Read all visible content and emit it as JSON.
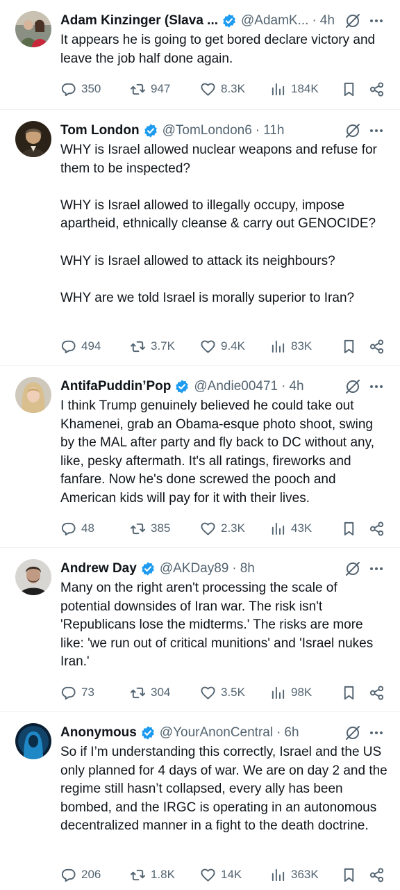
{
  "colors": {
    "verified": "#1d9bf0",
    "text": "#0f1419",
    "muted": "#536471",
    "divider": "#eff3f4"
  },
  "icons": {
    "verified": "verified-badge-icon",
    "grok": "grok-icon",
    "more": "more-icon",
    "reply": "reply-icon",
    "retweet": "retweet-icon",
    "like": "like-icon",
    "views": "views-icon",
    "bookmark": "bookmark-icon",
    "share": "share-icon"
  },
  "tweets": [
    {
      "name": "Adam Kinzinger (Slava ...",
      "handle": "@AdamK...",
      "sep": "·",
      "time": "4h",
      "text": "It appears he is going to get bored declare victory and leave the job half done again.",
      "replies": "350",
      "retweets": "947",
      "likes": "8.3K",
      "views": "184K"
    },
    {
      "name": "Tom London",
      "handle": "@TomLondon6",
      "sep": "·",
      "time": "11h",
      "text": "WHY is Israel allowed nuclear weapons and refuse for them to be inspected?\n\nWHY is Israel allowed to illegally occupy, impose apartheid, ethnically cleanse & carry out GENOCIDE?\n\nWHY is Israel allowed to attack its neighbours?\n\nWHY are we told Israel is morally superior to Iran?",
      "replies": "494",
      "retweets": "3.7K",
      "likes": "9.4K",
      "views": "83K"
    },
    {
      "name": "AntifaPuddin’Pop",
      "handle": "@Andie00471",
      "sep": "·",
      "time": "4h",
      "text": "I think Trump genuinely believed he could take out Khamenei, grab an Obama-esque photo shoot, swing by the MAL after party and fly back to DC without any, like, pesky aftermath. It's all ratings, fireworks and fanfare. Now he's done screwed the pooch and American kids will pay for it with their lives.",
      "replies": "48",
      "retweets": "385",
      "likes": "2.3K",
      "views": "43K"
    },
    {
      "name": "Andrew Day",
      "handle": "@AKDay89",
      "sep": "·",
      "time": "8h",
      "text": "Many on the right aren't processing the scale of potential downsides of Iran war. The risk isn't 'Republicans lose the midterms.' The risks are more like: 'we run out of critical munitions' and 'Israel nukes Iran.'",
      "replies": "73",
      "retweets": "304",
      "likes": "3.5K",
      "views": "98K"
    },
    {
      "name": "Anonymous",
      "handle": "@YourAnonCentral",
      "sep": "·",
      "time": "6h",
      "text": "So if I’m understanding this correctly, Israel and the US only planned for 4 days of war. We are on day 2 and the regime still hasn’t collapsed, every ally has been bombed, and the IRGC is operating in an autonomous decentralized manner in a fight to the death doctrine.",
      "replies": "206",
      "retweets": "1.8K",
      "likes": "14K",
      "views": "363K"
    }
  ]
}
